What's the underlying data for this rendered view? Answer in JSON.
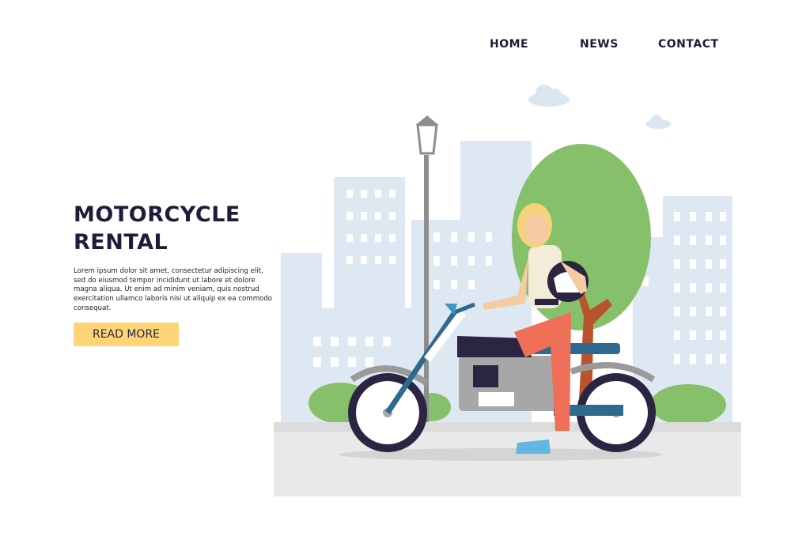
{
  "nav": {
    "items": [
      {
        "label": "HOME"
      },
      {
        "label": "NEWS"
      },
      {
        "label": "CONTACT"
      }
    ]
  },
  "hero": {
    "title": "MOTORCYCLE RENTAL",
    "body": "Lorem ipsum dolor sit amet, consectetur adipiscing elit, sed do eiusmod tempor incididunt ut labore et dolore magna aliqua. Ut enim ad minim veniam, quis nostrud exercitation ullamco laboris nisi ut aliquip ex ea commodo consequat.",
    "cta_label": "READ MORE"
  },
  "colors": {
    "accent_button": "#fdd577",
    "heading": "#1f1c3a",
    "building": "#dfe9f3",
    "tree": "#86c06a",
    "road": "#e9e9e9"
  },
  "illustration": {
    "subject": "woman-on-motorcycle",
    "icons": [
      "cloud-icon",
      "street-lamp-icon",
      "tree-icon",
      "building-icon",
      "motorcycle-icon",
      "helmet-icon"
    ]
  }
}
